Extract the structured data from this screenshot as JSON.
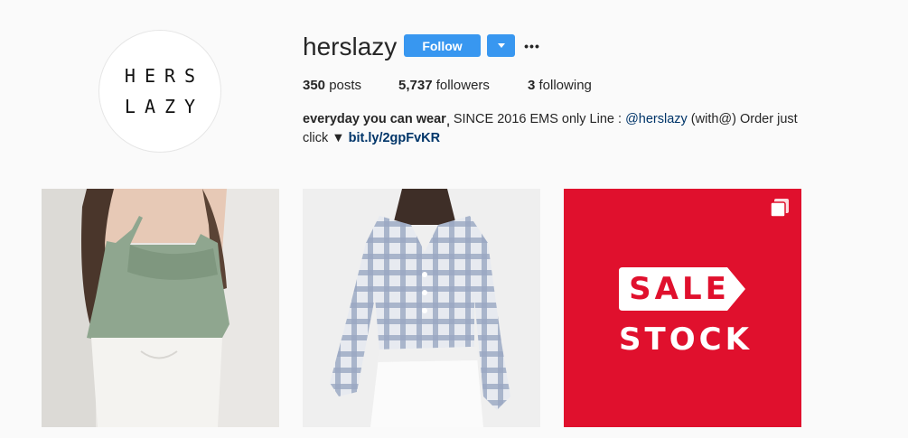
{
  "profile": {
    "avatar_line1": "HERS",
    "avatar_line2": "LAZY",
    "username": "herslazy",
    "follow_label": "Follow",
    "stats": {
      "posts_count": "350",
      "posts_label": " posts",
      "followers_count": "5,737",
      "followers_label": " followers",
      "following_count": "3",
      "following_label": " following"
    },
    "bio": {
      "name": "everyday you can wear",
      "text_1": " ฺฺ SINCE 2016 EMS only Line : ",
      "mention": "@herslazy",
      "text_2": " (with@) Order just click ▼ ",
      "link": "bit.ly/2gpFvKR"
    }
  },
  "posts": [
    {
      "alt_name": "green-ruffle-top"
    },
    {
      "alt_name": "plaid-cropped-top"
    },
    {
      "sale_line1": "SALE",
      "sale_line2": "STOCK",
      "icon": "multi-photo-icon"
    }
  ],
  "colors": {
    "accent": "#3897f0",
    "sale_red": "#e0102d",
    "link": "#003569",
    "background": "#fafafa"
  }
}
